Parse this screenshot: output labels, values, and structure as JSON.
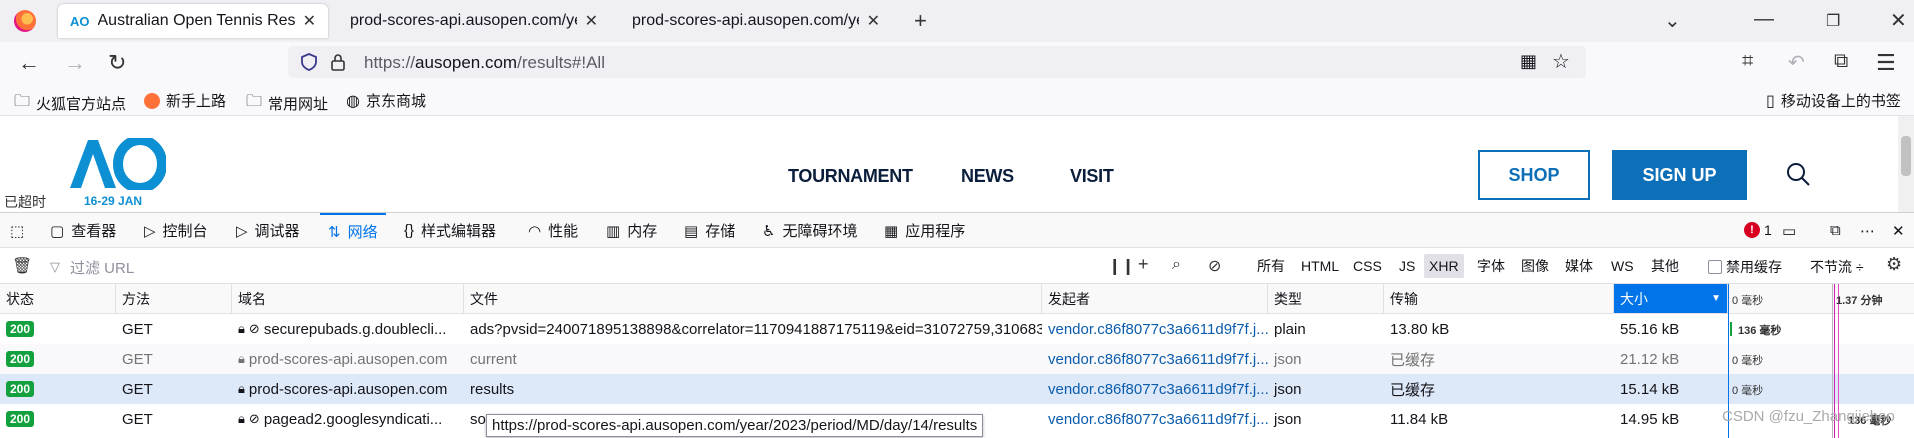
{
  "browser": {
    "tabs": [
      {
        "title": "Australian Open Tennis Results",
        "active": true
      },
      {
        "title": "prod-scores-api.ausopen.com/year",
        "active": false
      },
      {
        "title": "prod-scores-api.ausopen.com/year",
        "active": false
      }
    ],
    "new_tab": "+",
    "url_prefix": "https://",
    "url_host": "ausopen.com",
    "url_path": "/results#!All"
  },
  "bookmarks": {
    "items": [
      "火狐官方站点",
      "新手上路",
      "常用网址",
      "京东商城"
    ],
    "mobile": "移动设备上的书签"
  },
  "site": {
    "logo_text": "AO",
    "date": "16-29 JAN",
    "timeout": "已超时",
    "nav": [
      "TOURNAMENT",
      "NEWS",
      "VISIT"
    ],
    "shop": "SHOP",
    "signup": "SIGN UP",
    "brand_color": "#0d6fb8"
  },
  "devtools": {
    "tabs": [
      "查看器",
      "控制台",
      "调试器",
      "网络",
      "样式编辑器",
      "性能",
      "内存",
      "存储",
      "无障碍环境",
      "应用程序"
    ],
    "active_tab": "网络",
    "error_count": "1",
    "filter_placeholder": "过滤 URL",
    "types": [
      "所有",
      "HTML",
      "CSS",
      "JS",
      "XHR",
      "字体",
      "图像",
      "媒体",
      "WS",
      "其他"
    ],
    "active_type": "XHR",
    "disable_cache": "禁用缓存",
    "throttle": "不节流 ÷"
  },
  "table": {
    "headers": [
      "状态",
      "方法",
      "域名",
      "文件",
      "发起者",
      "类型",
      "传输",
      "大小"
    ],
    "timing": {
      "t0": "0 毫秒",
      "t1": "1.37 分钟"
    },
    "rows": [
      {
        "status": "200",
        "method": "GET",
        "domain": "securepubads.g.doublecli...",
        "file": "ads?pvsid=240071895138898&correlator=1170941887175119&eid=31072759,310683",
        "initiator": "vendor.c86f8077c3a6611d9f7f.j...",
        "type": "plain",
        "transfer": "13.80 kB",
        "size": "55.16 kB",
        "timing": "136 毫秒",
        "tracker": true
      },
      {
        "status": "200",
        "method": "GET",
        "domain": "prod-scores-api.ausopen.com",
        "file": "current",
        "initiator": "vendor.c86f8077c3a6611d9f7f.j...",
        "type": "json",
        "transfer": "已缓存",
        "size": "21.12 kB",
        "timing": "0 毫秒",
        "tracker": false
      },
      {
        "status": "200",
        "method": "GET",
        "domain": "prod-scores-api.ausopen.com",
        "file": "results",
        "initiator": "vendor.c86f8077c3a6611d9f7f.j...",
        "type": "json",
        "transfer": "已缓存",
        "size": "15.14 kB",
        "timing": "0 毫秒",
        "tracker": false
      },
      {
        "status": "200",
        "method": "GET",
        "domain": "pagead2.googlesyndicati...",
        "file": "so",
        "initiator": "vendor.c86f8077c3a6611d9f7f.j...",
        "type": "json",
        "transfer": "11.84 kB",
        "size": "14.95 kB",
        "timing": "136 毫秒",
        "tracker": true
      }
    ]
  },
  "tooltip": "https://prod-scores-api.ausopen.com/year/2023/period/MD/day/14/results",
  "watermark": "CSDN @fzu_Zhangjiehao"
}
